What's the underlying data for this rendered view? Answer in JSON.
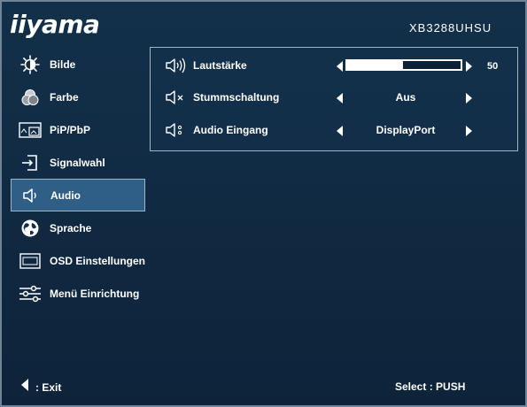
{
  "header": {
    "logo_text": "iiyama",
    "model": "XB3288UHSU"
  },
  "menu": {
    "items": [
      {
        "label": "Bilde",
        "icon": "brightness-icon",
        "active": false
      },
      {
        "label": "Farbe",
        "icon": "color-icon",
        "active": false
      },
      {
        "label": "PiP/PbP",
        "icon": "pip-icon",
        "active": false
      },
      {
        "label": "Signalwahl",
        "icon": "input-source-icon",
        "active": false
      },
      {
        "label": "Audio",
        "icon": "speaker-icon",
        "active": true
      },
      {
        "label": "Sprache",
        "icon": "globe-icon",
        "active": false
      },
      {
        "label": "OSD Einstellungen",
        "icon": "osd-icon",
        "active": false
      },
      {
        "label": "Menü Einrichtung",
        "icon": "sliders-icon",
        "active": false
      }
    ]
  },
  "audio_panel": {
    "volume": {
      "label": "Lautstärke",
      "value": "50",
      "level": 0.5,
      "icon": "speaker-volume-icon"
    },
    "mute": {
      "label": "Stummschaltung",
      "value": "Aus",
      "icon": "speaker-mute-icon"
    },
    "input": {
      "label": "Audio Eingang",
      "value": "DisplayPort",
      "icon": "speaker-input-icon"
    }
  },
  "footer": {
    "exit_label": ": Exit",
    "select_label": "Select  : PUSH"
  },
  "colors": {
    "background": "#102a42",
    "active_item": "#2f5f87",
    "border": "#9fb6c9"
  }
}
